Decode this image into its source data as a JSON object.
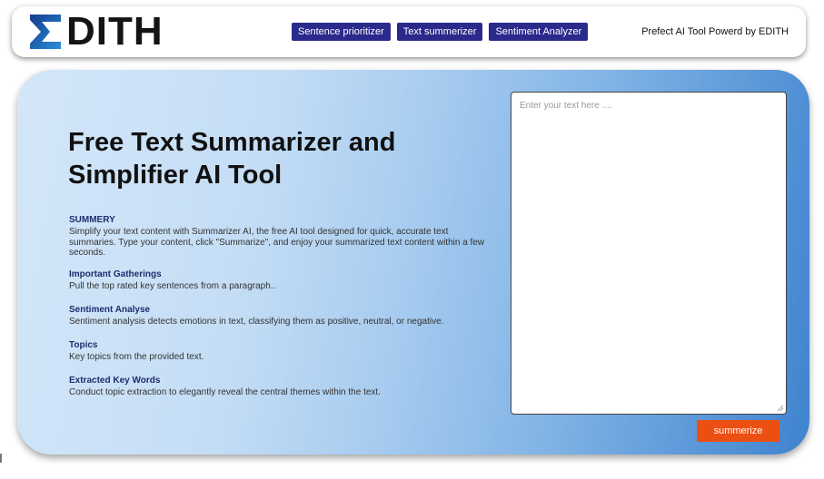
{
  "header": {
    "logo_icon": "sigma-icon",
    "logo_text": "DITH",
    "brand_color": "#2a6fc9",
    "nav": [
      {
        "label": "Sentence prioritizer"
      },
      {
        "label": "Text summerizer"
      },
      {
        "label": "Sentiment Analyzer"
      }
    ],
    "nav_color": "#2a2a8c",
    "tagline": "Prefect AI Tool Powerd by EDITH"
  },
  "main": {
    "title": "Free Text Summarizer and Simplifier AI Tool",
    "sections": [
      {
        "heading": "SUMMERY",
        "text": "Simplify your text content with Summarizer AI, the free AI tool designed for quick, accurate text summaries. Type your content, click \"Summarize\", and enjoy your summarized text content within a few seconds."
      },
      {
        "heading": "Important Gatherings",
        "text": "Pull the top rated key sentences from a paragraph.."
      },
      {
        "heading": "Sentiment Analyse",
        "text": "Sentiment analysis detects emotions in text, classifying them as positive, neutral, or negative."
      },
      {
        "heading": "Topics",
        "text": "Key topics from the provided text."
      },
      {
        "heading": "Extracted Key Words",
        "text": "Conduct topic extraction to elegantly reveal the central themes within the text."
      }
    ],
    "input": {
      "placeholder": "Enter your text here ...."
    },
    "submit_label": "summerize",
    "submit_color": "#ec4f12"
  }
}
